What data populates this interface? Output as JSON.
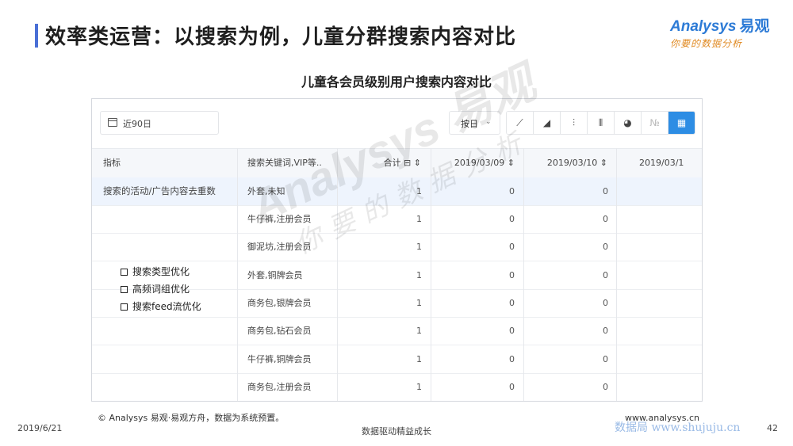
{
  "page": {
    "title": "效率类运营：以搜索为例，儿童分群搜索内容对比",
    "chart_title": "儿童各会员级别用户搜索内容对比"
  },
  "logo": {
    "brand": "Analysys",
    "brand_cn": "易观",
    "tagline": "你要的数据分析"
  },
  "filters": {
    "date_range": "近90日",
    "granularity": "按日",
    "granularity_chevron": "⌄"
  },
  "toolbar": {
    "buttons": [
      {
        "name": "line-chart-icon",
        "glyph": "⟋"
      },
      {
        "name": "area-chart-icon",
        "glyph": "◢"
      },
      {
        "name": "bar-line-chart-icon",
        "glyph": "⫶"
      },
      {
        "name": "bar-chart-icon",
        "glyph": "⫴"
      },
      {
        "name": "pie-chart-icon",
        "glyph": "◕"
      },
      {
        "name": "number-icon",
        "glyph": "№"
      },
      {
        "name": "table-icon",
        "glyph": "▦"
      }
    ],
    "active_color": "#2d8de4"
  },
  "table": {
    "headers": {
      "metric": "指标",
      "keyword": "搜索关键词,VIP等..",
      "total": "合计 ⊟ ⇕",
      "d1": "2019/03/09 ⇕",
      "d2": "2019/03/10 ⇕",
      "d3": "2019/03/1"
    },
    "metric_label": "搜索的活动/广告内容去重数",
    "rows": [
      {
        "keyword": "外套,未知",
        "total": "1",
        "d1": "0",
        "d2": "0"
      },
      {
        "keyword": "牛仔裤,注册会员",
        "total": "1",
        "d1": "0",
        "d2": "0"
      },
      {
        "keyword": "御泥坊,注册会员",
        "total": "1",
        "d1": "0",
        "d2": "0"
      },
      {
        "keyword": "外套,铜牌会员",
        "total": "1",
        "d1": "0",
        "d2": "0"
      },
      {
        "keyword": "商务包,银牌会员",
        "total": "1",
        "d1": "0",
        "d2": "0"
      },
      {
        "keyword": "商务包,钻石会员",
        "total": "1",
        "d1": "0",
        "d2": "0"
      },
      {
        "keyword": "牛仔裤,铜牌会员",
        "total": "1",
        "d1": "0",
        "d2": "0"
      },
      {
        "keyword": "商务包,注册会员",
        "total": "1",
        "d1": "0",
        "d2": "0"
      }
    ]
  },
  "bullets": [
    "搜索类型优化",
    "高频词组优化",
    "搜索feed流优化"
  ],
  "watermark": {
    "main": "Analysys 易观",
    "sub": "你要的数据分析"
  },
  "footer": {
    "copyright": "© Analysys 易观·易观方舟，数据为系统预置。",
    "website": "www.analysys.cn",
    "date": "2019/6/21",
    "slogan": "数据驱动精益成长",
    "site_watermark": "数据局  www.shujuju.cn",
    "page_number": "42"
  }
}
